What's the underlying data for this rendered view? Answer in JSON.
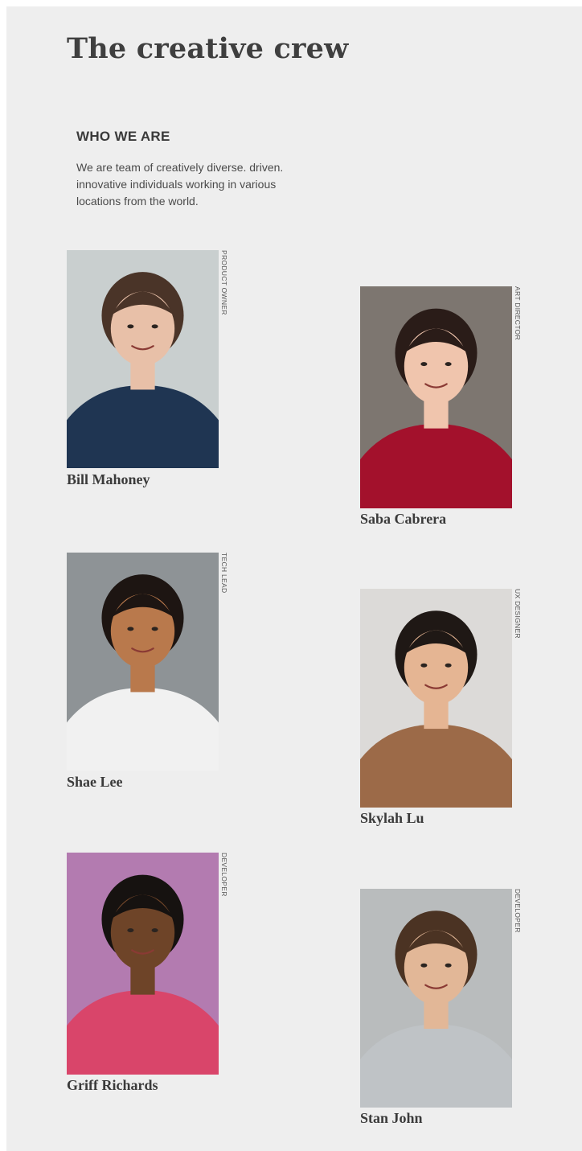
{
  "page": {
    "title": "The creative crew"
  },
  "about": {
    "heading": "WHO WE ARE",
    "text": "We are team of creatively diverse. driven. innovative individuals working in various locations from the world."
  },
  "team": [
    {
      "name": "Bill Mahoney",
      "role": "PRODUCT OWNER",
      "photo": "portrait-photo",
      "colors": {
        "bg": "#c9cfcf",
        "skin": "#e8c0a8",
        "hair": "#4a3428",
        "shirt": "#1f3552"
      }
    },
    {
      "name": "Saba Cabrera",
      "role": "ART DIRECTOR",
      "photo": "portrait-photo",
      "colors": {
        "bg": "#7d7670",
        "skin": "#f0c5ad",
        "hair": "#2a1c18",
        "shirt": "#a3112c"
      }
    },
    {
      "name": "Shae Lee",
      "role": "TECH LEAD",
      "photo": "portrait-photo",
      "colors": {
        "bg": "#8e9396",
        "skin": "#b9794c",
        "hair": "#1d1512",
        "shirt": "#f1f1f1"
      }
    },
    {
      "name": "Skylah Lu",
      "role": "UX DESIGNER",
      "photo": "portrait-photo",
      "colors": {
        "bg": "#dcdad8",
        "skin": "#e5b593",
        "hair": "#1f1815",
        "shirt": "#9c6a48"
      }
    },
    {
      "name": "Griff Richards",
      "role": "DEVELOPER",
      "photo": "portrait-photo",
      "colors": {
        "bg": "#b37bb0",
        "skin": "#6e4428",
        "hair": "#161210",
        "shirt": "#d9456a"
      }
    },
    {
      "name": "Stan John",
      "role": "DEVELOPER",
      "photo": "portrait-photo",
      "colors": {
        "bg": "#b9bcbd",
        "skin": "#e2b797",
        "hair": "#4b3323",
        "shirt": "#bfc3c6"
      }
    }
  ]
}
